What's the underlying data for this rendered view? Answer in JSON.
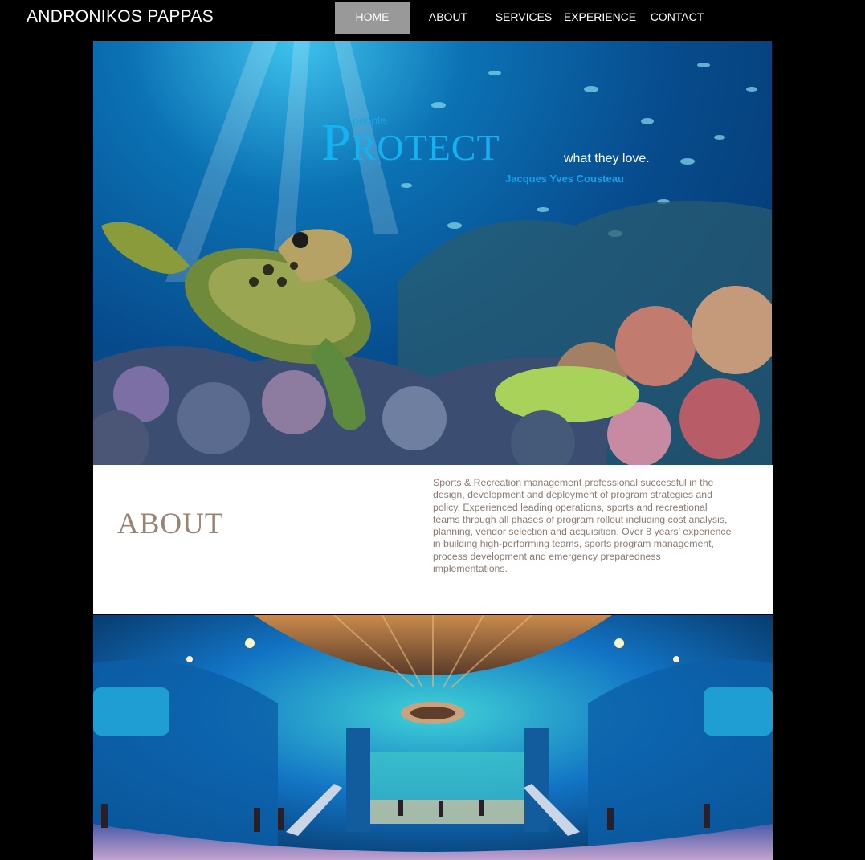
{
  "header": {
    "site_title": "ANDRONIKOS PAPPAS",
    "nav": [
      {
        "label": "HOME",
        "active": true
      },
      {
        "label": "ABOUT",
        "active": false
      },
      {
        "label": "SERVICES",
        "active": false
      },
      {
        "label": "EXPERIENCE",
        "active": false
      },
      {
        "label": "CONTACT",
        "active": false
      }
    ]
  },
  "hero": {
    "quote_people": "people",
    "quote_protect": "Protect",
    "quote_tail": "what they love.",
    "quote_author": "Jacques  Yves Cousteau"
  },
  "about": {
    "title": "ABOUT",
    "body": "Sports & Recreation management professional successful in the design, development and deployment of program strategies and policy. Experienced leading operations, sports and recreational teams through all phases of program rollout including cost analysis, planning, vendor selection and acquisition. Over 8 years’ experience in building high-performing teams, sports program management, process development and emergency preparedness implementations."
  },
  "colors": {
    "background": "#000000",
    "nav_active": "#999999",
    "about_title": "#9a8373",
    "about_text": "#8c7a6e",
    "quote_blue": "#14b2f0"
  }
}
